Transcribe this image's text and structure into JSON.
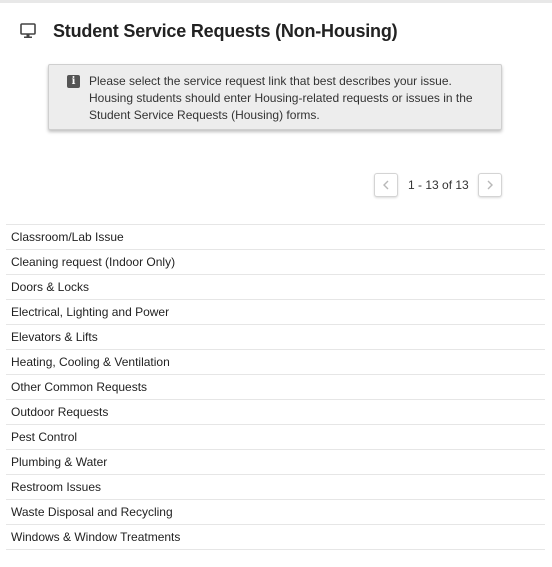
{
  "header": {
    "icon": "monitor-icon",
    "title": "Student Service Requests (Non-Housing)"
  },
  "info": {
    "icon": "info-icon",
    "line1": "Please select the service request link that best describes your issue.",
    "line2": "Housing students should enter Housing-related requests or issues in the",
    "line3": "Student Service Requests (Housing) forms."
  },
  "pager": {
    "prev_icon": "chevron-left-icon",
    "next_icon": "chevron-right-icon",
    "range_text": "1 - 13 of 13"
  },
  "requests": [
    "Classroom/Lab Issue",
    "Cleaning request (Indoor Only)",
    "Doors & Locks",
    "Electrical, Lighting and Power",
    "Elevators & Lifts",
    "Heating, Cooling & Ventilation",
    "Other Common Requests",
    "Outdoor Requests",
    "Pest Control",
    "Plumbing & Water",
    "Restroom Issues",
    "Waste Disposal and Recycling",
    "Windows & Window Treatments"
  ]
}
